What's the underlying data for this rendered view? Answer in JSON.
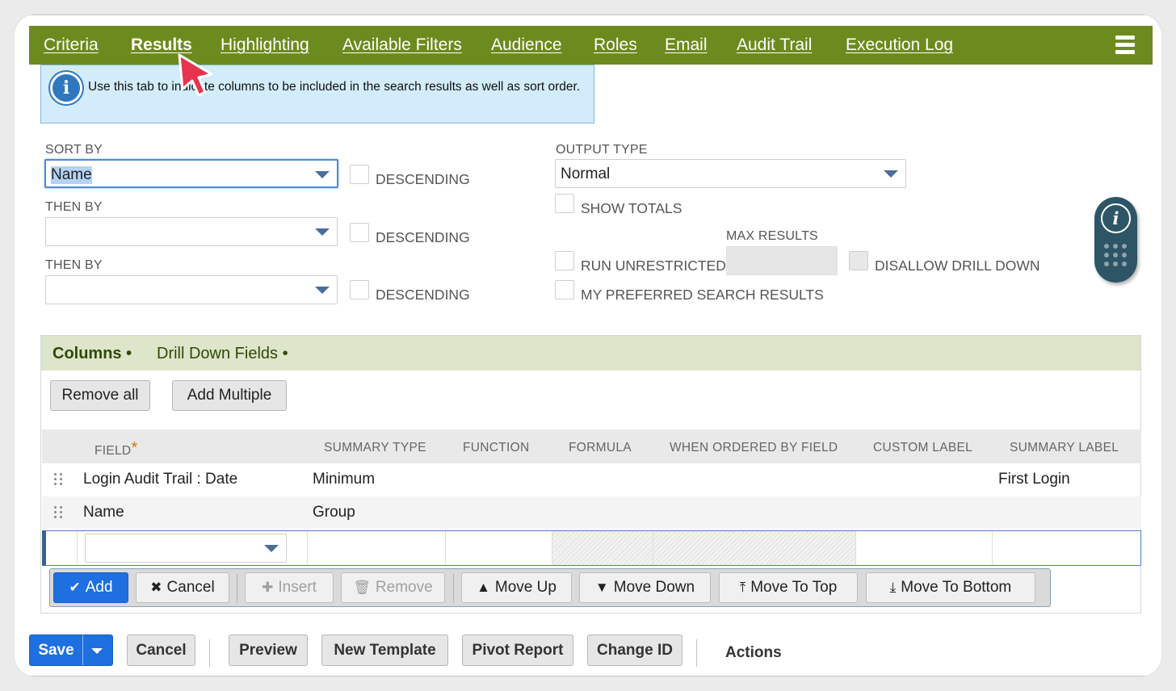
{
  "tabs": [
    {
      "label": "Criteria",
      "active": false
    },
    {
      "label": "Results",
      "active": true
    },
    {
      "label": "Highlighting",
      "active": false
    },
    {
      "label": "Available Filters",
      "active": false
    },
    {
      "label": "Audience",
      "active": false
    },
    {
      "label": "Roles",
      "active": false
    },
    {
      "label": "Email",
      "active": false
    },
    {
      "label": "Audit Trail",
      "active": false
    },
    {
      "label": "Execution Log",
      "active": false
    }
  ],
  "info": {
    "text": "Use this tab to indicate columns to be included in the search results as well as sort order."
  },
  "sort": {
    "sort_by_label": "SORT BY",
    "sort_by_value": "Name",
    "then_by_label": "THEN BY",
    "then_by_2_label": "THEN BY",
    "descending_label": "DESCENDING"
  },
  "output": {
    "output_type_label": "OUTPUT TYPE",
    "output_type_value": "Normal",
    "show_totals": "SHOW TOTALS",
    "max_results": "MAX RESULTS",
    "run_unrestricted": "RUN UNRESTRICTED",
    "disallow_drill_down": "DISALLOW DRILL DOWN",
    "my_preferred": "MY PREFERRED SEARCH RESULTS"
  },
  "panel": {
    "tabs": [
      "Columns •",
      "Drill Down Fields •"
    ],
    "remove_all": "Remove all",
    "add_multiple": "Add Multiple",
    "headers": [
      "FIELD",
      "SUMMARY TYPE",
      "FUNCTION",
      "FORMULA",
      "WHEN ORDERED BY FIELD",
      "CUSTOM LABEL",
      "SUMMARY LABEL"
    ],
    "required_mark": "*",
    "rows": [
      {
        "field": "Login Audit Trail : Date",
        "summary_type": "Minimum",
        "summary_label": "First Login"
      },
      {
        "field": "Name",
        "summary_type": "Group",
        "summary_label": ""
      }
    ],
    "toolbar": {
      "add": "Add",
      "cancel": "Cancel",
      "insert": "Insert",
      "remove": "Remove",
      "move_up": "Move Up",
      "move_down": "Move Down",
      "move_to_top": "Move To Top",
      "move_to_bottom": "Move To Bottom"
    }
  },
  "bottom": {
    "save": "Save",
    "cancel": "Cancel",
    "preview": "Preview",
    "new_template": "New Template",
    "pivot_report": "Pivot Report",
    "change_id": "Change ID",
    "actions": "Actions"
  },
  "colors": {
    "tab_bar": "#6d8a1e",
    "primary": "#1e6fe0",
    "info_bg": "#d3ecfb",
    "panel_tab_bg": "#dde5cb"
  }
}
